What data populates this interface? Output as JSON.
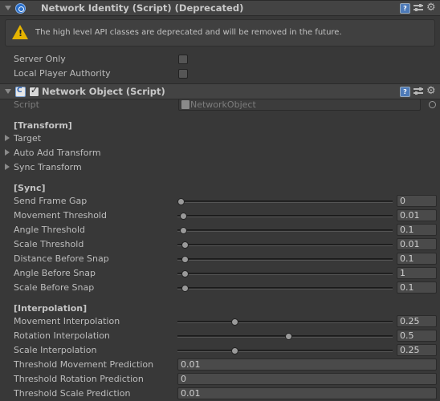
{
  "identity": {
    "title": "Network Identity (Script) (Deprecated)",
    "warning": "The high level API classes are deprecated and will be removed in the future.",
    "props": [
      {
        "label": "Server Only",
        "checked": false
      },
      {
        "label": "Local Player Authority",
        "checked": false
      }
    ]
  },
  "object": {
    "title": "Network Object (Script)",
    "enabled": true,
    "script_label": "Script",
    "script_value": "NetworkObject"
  },
  "transform": {
    "header": "[Transform]",
    "items": [
      "Target",
      "Auto Add Transform",
      "Sync Transform"
    ]
  },
  "sync": {
    "header": "[Sync]",
    "rows": [
      {
        "label": "Send Frame Gap",
        "value": "0",
        "fraction": 0.0
      },
      {
        "label": "Movement Threshold",
        "value": "0.01",
        "fraction": 0.01
      },
      {
        "label": "Angle Threshold",
        "value": "0.1",
        "fraction": 0.01
      },
      {
        "label": "Scale Threshold",
        "value": "0.01",
        "fraction": 0.02
      },
      {
        "label": "Distance Before Snap",
        "value": "0.1",
        "fraction": 0.02
      },
      {
        "label": "Angle Before Snap",
        "value": "1",
        "fraction": 0.02
      },
      {
        "label": "Scale Before Snap",
        "value": "0.1",
        "fraction": 0.02
      }
    ]
  },
  "interpolation": {
    "header": "[Interpolation]",
    "rows": [
      {
        "label": "Movement Interpolation",
        "value": "0.25",
        "fraction": 0.25
      },
      {
        "label": "Rotation Interpolation",
        "value": "0.5",
        "fraction": 0.5
      },
      {
        "label": "Scale Interpolation",
        "value": "0.25",
        "fraction": 0.25
      }
    ],
    "predictions": [
      {
        "label": "Threshold Movement Prediction",
        "value": "0.01"
      },
      {
        "label": "Threshold Rotation Prediction",
        "value": "0"
      },
      {
        "label": "Threshold Scale Prediction",
        "value": "0.01"
      }
    ]
  },
  "colors": {
    "background": "#383838",
    "header": "#434343",
    "warning": "#e6b400",
    "field": "#4a4a4a"
  },
  "icons": {
    "identity": "network-icon",
    "object": "csharp-script-icon",
    "help": "help-icon",
    "preset": "preset-icon",
    "settings": "gear-icon",
    "warning": "warning-icon"
  }
}
